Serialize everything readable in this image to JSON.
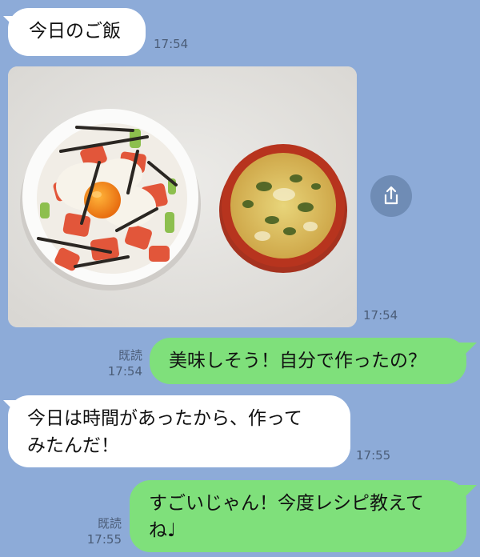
{
  "messages": [
    {
      "id": "m1",
      "side": "in",
      "text": "今日のご飯",
      "time": "17:54"
    },
    {
      "id": "m2",
      "side": "in",
      "type": "photo",
      "time": "17:54"
    },
    {
      "id": "m3",
      "side": "out",
      "text": "美味しそう！自分で作ったの？",
      "read": "既読",
      "time": "17:54"
    },
    {
      "id": "m4",
      "side": "in",
      "lines": [
        "今日は時間があったから、作って",
        "みたんだ！"
      ],
      "time": "17:55"
    },
    {
      "id": "m5",
      "side": "out",
      "lines": [
        "すごいじゃん！今度レシピ教えて",
        "ね♩"
      ],
      "read": "既読",
      "time": "17:55"
    }
  ],
  "icons": {
    "share": "share-icon"
  },
  "colors": {
    "background": "#8dabd8",
    "incoming": "#ffffff",
    "outgoing": "#7fe07b"
  }
}
